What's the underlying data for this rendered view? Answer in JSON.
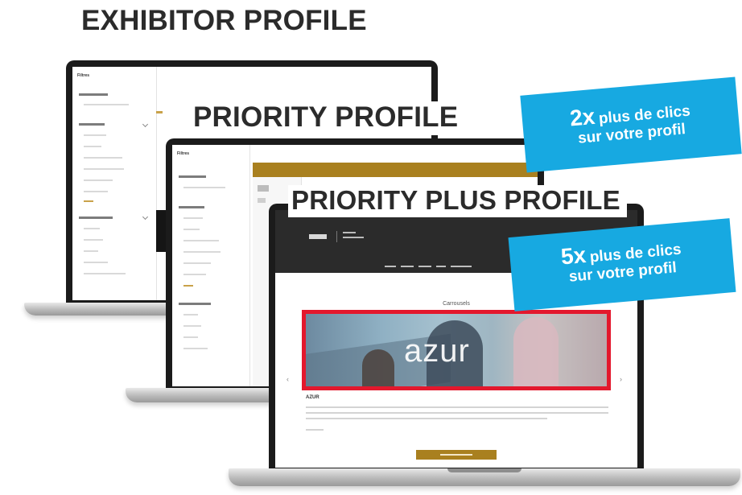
{
  "headings": {
    "exhibitor": "EXHIBITOR PROFILE",
    "priority": "PRIORITY PROFILE",
    "priority_plus": "PRIORITY PLUS PROFILE"
  },
  "badges": [
    {
      "multiplier": "2x",
      "line1": "plus de clics",
      "line2": "sur votre profil"
    },
    {
      "multiplier": "5x",
      "line1": "plus de clics",
      "line2": "sur votre profil"
    }
  ],
  "screens": {
    "filters_title": "Filtres",
    "priority_plus": {
      "section_title": "Carrousels",
      "hero_text": "azur",
      "company_name": "AZUR"
    }
  },
  "colors": {
    "badge_blue": "#17a9e1",
    "highlight_red": "#e3182d",
    "gold": "#a9801f",
    "laptop_frame": "#1b1b1b"
  }
}
